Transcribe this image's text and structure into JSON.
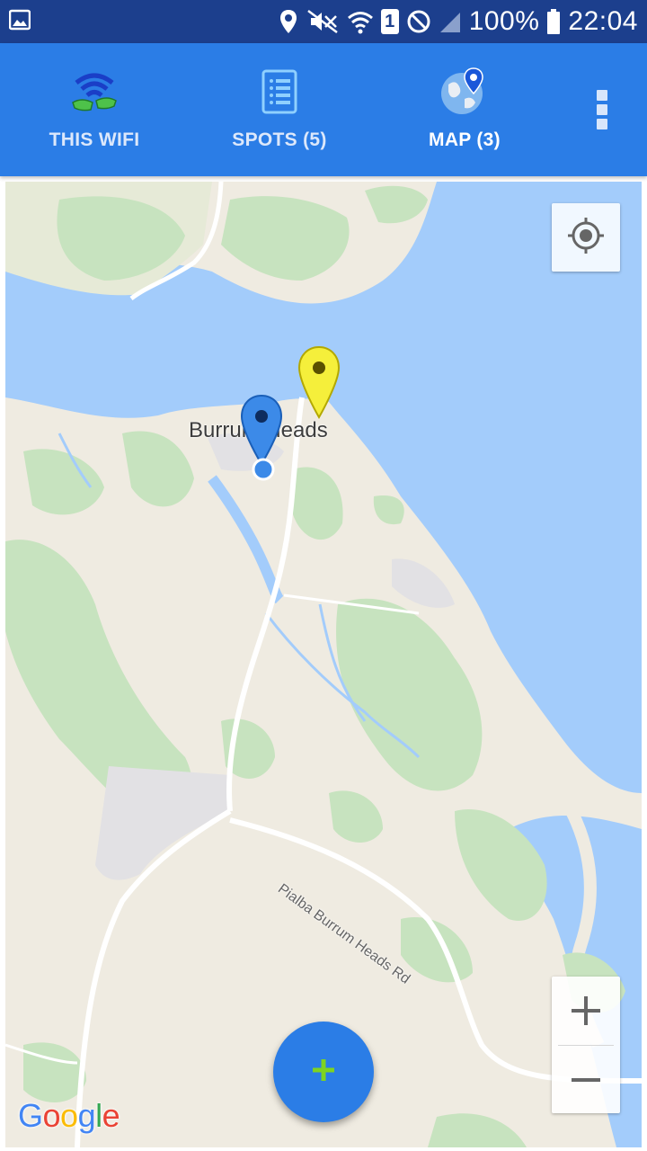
{
  "status_bar": {
    "battery": "100%",
    "time": "22:04",
    "sim_slot": "1",
    "icons": [
      "image-icon",
      "location-icon",
      "mute-icon",
      "wifi-icon",
      "sim-icon",
      "block-icon",
      "signal-icon",
      "battery-icon"
    ]
  },
  "tabs": [
    {
      "label": "THIS WIFI",
      "icon": "wifi-hands-icon",
      "active": false
    },
    {
      "label": "SPOTS (5)",
      "icon": "list-icon",
      "active": false
    },
    {
      "label": "MAP (3)",
      "icon": "globe-pin-icon",
      "active": true
    }
  ],
  "map": {
    "place_label": "Burrum Heads",
    "road_label": "Pialba Burrum Heads Rd",
    "attribution": "Google",
    "markers": [
      {
        "name": "yellow-marker",
        "color": "#f5ef3b"
      },
      {
        "name": "blue-marker",
        "color": "#3c8ae8"
      }
    ],
    "zoom_in": "+",
    "zoom_out": "−"
  },
  "fab": {
    "label": "+",
    "color": "#7ed321"
  },
  "colors": {
    "status_bar": "#1c3f8d",
    "app_bar": "#2b7de6",
    "water": "#a3ccfb",
    "land": "#efebe1",
    "park": "#c7e3bf"
  }
}
